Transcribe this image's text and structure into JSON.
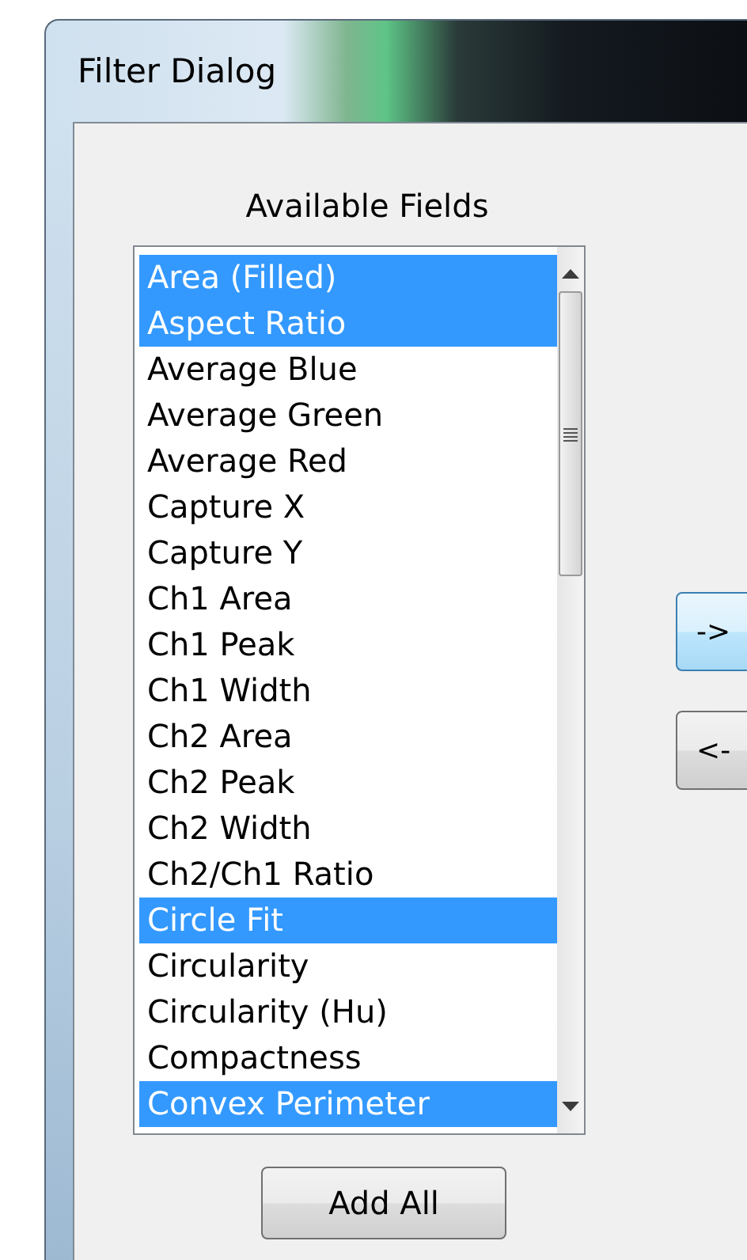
{
  "window": {
    "title": "Filter Dialog"
  },
  "available_fields": {
    "label": "Available Fields",
    "items": [
      {
        "text": "Area (Filled)",
        "selected": true
      },
      {
        "text": "Aspect Ratio",
        "selected": true
      },
      {
        "text": "Average Blue",
        "selected": false
      },
      {
        "text": "Average Green",
        "selected": false
      },
      {
        "text": "Average Red",
        "selected": false
      },
      {
        "text": "Capture X",
        "selected": false
      },
      {
        "text": "Capture Y",
        "selected": false
      },
      {
        "text": "Ch1 Area",
        "selected": false
      },
      {
        "text": "Ch1 Peak",
        "selected": false
      },
      {
        "text": "Ch1 Width",
        "selected": false
      },
      {
        "text": "Ch2 Area",
        "selected": false
      },
      {
        "text": "Ch2 Peak",
        "selected": false
      },
      {
        "text": "Ch2 Width",
        "selected": false
      },
      {
        "text": "Ch2/Ch1 Ratio",
        "selected": false
      },
      {
        "text": "Circle Fit",
        "selected": true
      },
      {
        "text": "Circularity",
        "selected": false
      },
      {
        "text": "Circularity (Hu)",
        "selected": false
      },
      {
        "text": "Compactness",
        "selected": false
      },
      {
        "text": "Convex Perimeter",
        "selected": true
      }
    ],
    "add_all_button": "Add All"
  },
  "move_buttons": [
    {
      "label": "->",
      "highlighted": true
    },
    {
      "label": "<-",
      "highlighted": false
    }
  ]
}
